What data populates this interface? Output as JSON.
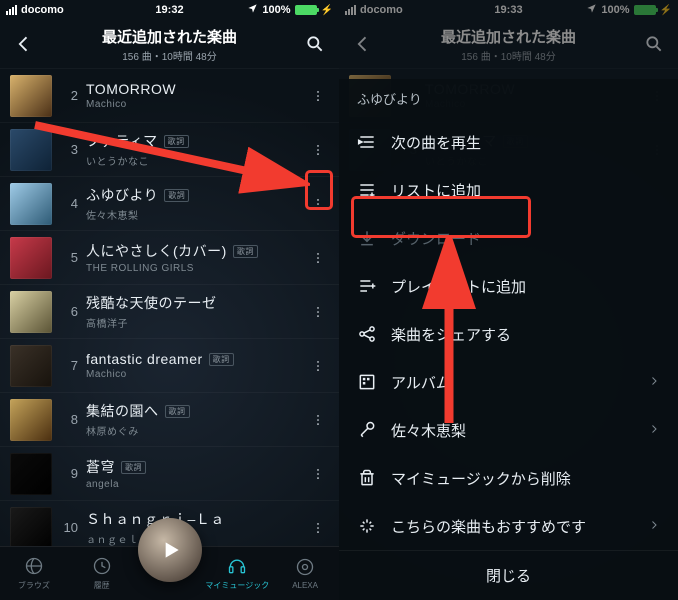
{
  "status": {
    "carrier": "docomo",
    "time": "19:32",
    "time_right": "19:33",
    "battery": "100%"
  },
  "header": {
    "title": "最近追加された楽曲",
    "subtitle": "156 曲・10時間 48分"
  },
  "tracks": [
    {
      "n": "2",
      "title": "TOMORROW",
      "artist": "Machico",
      "lyr": false
    },
    {
      "n": "3",
      "title": "ファティマ",
      "artist": "いとうかなこ",
      "lyr": true,
      "lyr_label": "歌詞"
    },
    {
      "n": "4",
      "title": "ふゆびより",
      "artist": "佐々木恵梨",
      "lyr": true,
      "lyr_label": "歌詞"
    },
    {
      "n": "5",
      "title": "人にやさしく(カバー)",
      "artist": "THE ROLLING GIRLS",
      "lyr": true,
      "lyr_label": "歌詞"
    },
    {
      "n": "6",
      "title": "残酷な天使のテーゼ",
      "artist": "高橋洋子",
      "lyr": false
    },
    {
      "n": "7",
      "title": "fantastic dreamer",
      "artist": "Machico",
      "lyr": true,
      "lyr_label": "歌詞"
    },
    {
      "n": "8",
      "title": "集結の園へ",
      "artist": "林原めぐみ",
      "lyr": true,
      "lyr_label": "歌詞"
    },
    {
      "n": "9",
      "title": "蒼穹",
      "artist": "angela",
      "lyr": true,
      "lyr_label": "歌詞"
    },
    {
      "n": "10",
      "title": "Ｓｈａｎｇｒｉ–Ｌａ",
      "artist": "ａｎｇｅｌａ",
      "lyr": false
    }
  ],
  "tabs": {
    "browse": "ブラウズ",
    "history": "履歴",
    "mymusic": "マイミュージック",
    "alexa": "ALEXA"
  },
  "sheet": {
    "track_title": "ふゆびより",
    "play_next": "次の曲を再生",
    "add_list": "リストに追加",
    "download": "ダウンロード",
    "add_playlist": "プレイリストに追加",
    "share": "楽曲をシェアする",
    "album": "アルバム",
    "artist": "佐々木恵梨",
    "remove": "マイミュージックから削除",
    "recommend": "こちらの楽曲もおすすめです",
    "close": "閉じる"
  }
}
